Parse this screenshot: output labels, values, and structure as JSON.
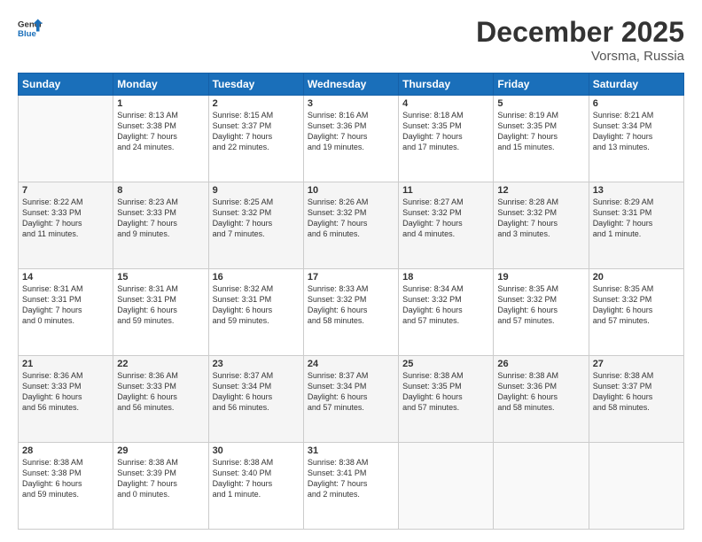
{
  "logo": {
    "line1": "General",
    "line2": "Blue"
  },
  "title": "December 2025",
  "location": "Vorsma, Russia",
  "days_header": [
    "Sunday",
    "Monday",
    "Tuesday",
    "Wednesday",
    "Thursday",
    "Friday",
    "Saturday"
  ],
  "weeks": [
    {
      "shade": false,
      "cells": [
        {
          "empty": true
        },
        {
          "day": "1",
          "lines": [
            "Sunrise: 8:13 AM",
            "Sunset: 3:38 PM",
            "Daylight: 7 hours",
            "and 24 minutes."
          ]
        },
        {
          "day": "2",
          "lines": [
            "Sunrise: 8:15 AM",
            "Sunset: 3:37 PM",
            "Daylight: 7 hours",
            "and 22 minutes."
          ]
        },
        {
          "day": "3",
          "lines": [
            "Sunrise: 8:16 AM",
            "Sunset: 3:36 PM",
            "Daylight: 7 hours",
            "and 19 minutes."
          ]
        },
        {
          "day": "4",
          "lines": [
            "Sunrise: 8:18 AM",
            "Sunset: 3:35 PM",
            "Daylight: 7 hours",
            "and 17 minutes."
          ]
        },
        {
          "day": "5",
          "lines": [
            "Sunrise: 8:19 AM",
            "Sunset: 3:35 PM",
            "Daylight: 7 hours",
            "and 15 minutes."
          ]
        },
        {
          "day": "6",
          "lines": [
            "Sunrise: 8:21 AM",
            "Sunset: 3:34 PM",
            "Daylight: 7 hours",
            "and 13 minutes."
          ]
        }
      ]
    },
    {
      "shade": true,
      "cells": [
        {
          "day": "7",
          "lines": [
            "Sunrise: 8:22 AM",
            "Sunset: 3:33 PM",
            "Daylight: 7 hours",
            "and 11 minutes."
          ]
        },
        {
          "day": "8",
          "lines": [
            "Sunrise: 8:23 AM",
            "Sunset: 3:33 PM",
            "Daylight: 7 hours",
            "and 9 minutes."
          ]
        },
        {
          "day": "9",
          "lines": [
            "Sunrise: 8:25 AM",
            "Sunset: 3:32 PM",
            "Daylight: 7 hours",
            "and 7 minutes."
          ]
        },
        {
          "day": "10",
          "lines": [
            "Sunrise: 8:26 AM",
            "Sunset: 3:32 PM",
            "Daylight: 7 hours",
            "and 6 minutes."
          ]
        },
        {
          "day": "11",
          "lines": [
            "Sunrise: 8:27 AM",
            "Sunset: 3:32 PM",
            "Daylight: 7 hours",
            "and 4 minutes."
          ]
        },
        {
          "day": "12",
          "lines": [
            "Sunrise: 8:28 AM",
            "Sunset: 3:32 PM",
            "Daylight: 7 hours",
            "and 3 minutes."
          ]
        },
        {
          "day": "13",
          "lines": [
            "Sunrise: 8:29 AM",
            "Sunset: 3:31 PM",
            "Daylight: 7 hours",
            "and 1 minute."
          ]
        }
      ]
    },
    {
      "shade": false,
      "cells": [
        {
          "day": "14",
          "lines": [
            "Sunrise: 8:31 AM",
            "Sunset: 3:31 PM",
            "Daylight: 7 hours",
            "and 0 minutes."
          ]
        },
        {
          "day": "15",
          "lines": [
            "Sunrise: 8:31 AM",
            "Sunset: 3:31 PM",
            "Daylight: 6 hours",
            "and 59 minutes."
          ]
        },
        {
          "day": "16",
          "lines": [
            "Sunrise: 8:32 AM",
            "Sunset: 3:31 PM",
            "Daylight: 6 hours",
            "and 59 minutes."
          ]
        },
        {
          "day": "17",
          "lines": [
            "Sunrise: 8:33 AM",
            "Sunset: 3:32 PM",
            "Daylight: 6 hours",
            "and 58 minutes."
          ]
        },
        {
          "day": "18",
          "lines": [
            "Sunrise: 8:34 AM",
            "Sunset: 3:32 PM",
            "Daylight: 6 hours",
            "and 57 minutes."
          ]
        },
        {
          "day": "19",
          "lines": [
            "Sunrise: 8:35 AM",
            "Sunset: 3:32 PM",
            "Daylight: 6 hours",
            "and 57 minutes."
          ]
        },
        {
          "day": "20",
          "lines": [
            "Sunrise: 8:35 AM",
            "Sunset: 3:32 PM",
            "Daylight: 6 hours",
            "and 57 minutes."
          ]
        }
      ]
    },
    {
      "shade": true,
      "cells": [
        {
          "day": "21",
          "lines": [
            "Sunrise: 8:36 AM",
            "Sunset: 3:33 PM",
            "Daylight: 6 hours",
            "and 56 minutes."
          ]
        },
        {
          "day": "22",
          "lines": [
            "Sunrise: 8:36 AM",
            "Sunset: 3:33 PM",
            "Daylight: 6 hours",
            "and 56 minutes."
          ]
        },
        {
          "day": "23",
          "lines": [
            "Sunrise: 8:37 AM",
            "Sunset: 3:34 PM",
            "Daylight: 6 hours",
            "and 56 minutes."
          ]
        },
        {
          "day": "24",
          "lines": [
            "Sunrise: 8:37 AM",
            "Sunset: 3:34 PM",
            "Daylight: 6 hours",
            "and 57 minutes."
          ]
        },
        {
          "day": "25",
          "lines": [
            "Sunrise: 8:38 AM",
            "Sunset: 3:35 PM",
            "Daylight: 6 hours",
            "and 57 minutes."
          ]
        },
        {
          "day": "26",
          "lines": [
            "Sunrise: 8:38 AM",
            "Sunset: 3:36 PM",
            "Daylight: 6 hours",
            "and 58 minutes."
          ]
        },
        {
          "day": "27",
          "lines": [
            "Sunrise: 8:38 AM",
            "Sunset: 3:37 PM",
            "Daylight: 6 hours",
            "and 58 minutes."
          ]
        }
      ]
    },
    {
      "shade": false,
      "cells": [
        {
          "day": "28",
          "lines": [
            "Sunrise: 8:38 AM",
            "Sunset: 3:38 PM",
            "Daylight: 6 hours",
            "and 59 minutes."
          ]
        },
        {
          "day": "29",
          "lines": [
            "Sunrise: 8:38 AM",
            "Sunset: 3:39 PM",
            "Daylight: 7 hours",
            "and 0 minutes."
          ]
        },
        {
          "day": "30",
          "lines": [
            "Sunrise: 8:38 AM",
            "Sunset: 3:40 PM",
            "Daylight: 7 hours",
            "and 1 minute."
          ]
        },
        {
          "day": "31",
          "lines": [
            "Sunrise: 8:38 AM",
            "Sunset: 3:41 PM",
            "Daylight: 7 hours",
            "and 2 minutes."
          ]
        },
        {
          "empty": true
        },
        {
          "empty": true
        },
        {
          "empty": true
        }
      ]
    }
  ]
}
